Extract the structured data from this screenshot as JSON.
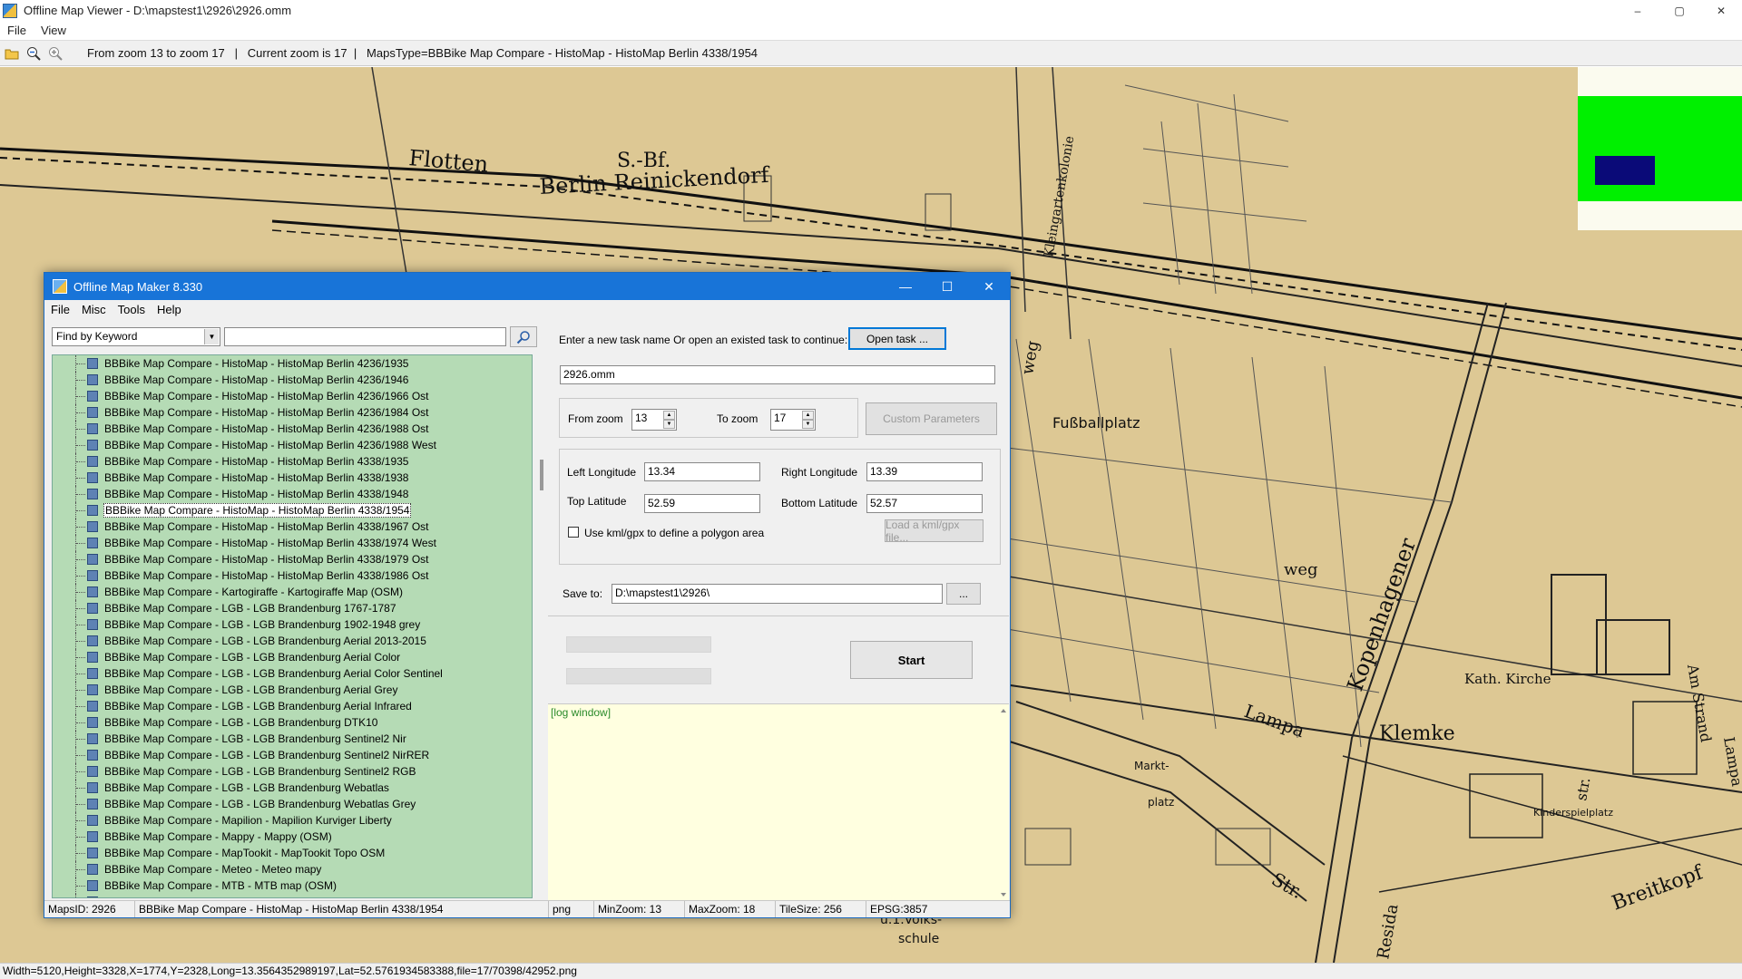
{
  "window": {
    "title": "Offline Map Viewer - D:\\mapstest1\\2926\\2926.omm",
    "controls": {
      "minimize": "–",
      "maximize": "▢",
      "close": "✕"
    }
  },
  "menu": [
    "File",
    "View"
  ],
  "toolbar": {
    "icons": [
      "open-folder-icon",
      "zoom-out-icon",
      "zoom-in-icon"
    ],
    "info": "From zoom 13 to zoom 17   |   Current zoom is 17  |   MapsType=BBBike Map Compare - HistoMap - HistoMap Berlin 4338/1954"
  },
  "map": {
    "labels": [
      "S.-Bf.",
      "Berlin-Reinickendorf",
      "Flotten",
      "Kleingartenkolonie",
      "Fußballplatz",
      "weg",
      "Kopenhagener",
      "Klemke",
      "Kath. Kirche",
      "Am Strand",
      "Kinderspielplatz",
      "Markt-",
      "platz",
      "Str.",
      "Breitkopf",
      "Resida",
      "u.1.Volks-",
      "schule",
      "str.",
      "weg",
      "Lampa"
    ],
    "overview_colors": {
      "background": "#fbfbef",
      "area": "#00f000",
      "viewport": "#0a0a78"
    }
  },
  "status_bar": "Width=5120,Height=3328,X=1774,Y=2328,Long=13.3564352989197,Lat=52.5761934583388,file=17/70398/42952.png",
  "dialog": {
    "title": "Offline Map Maker 8.330",
    "controls": {
      "minimize": "—",
      "maximize": "☐",
      "close": "✕"
    },
    "menu": [
      "File",
      "Misc",
      "Tools",
      "Help"
    ],
    "find": {
      "mode": "Find by Keyword",
      "query": ""
    },
    "tree_items": [
      "BBBike Map Compare - HistoMap - HistoMap Berlin 4236/1935",
      "BBBike Map Compare - HistoMap - HistoMap Berlin 4236/1946",
      "BBBike Map Compare - HistoMap - HistoMap Berlin 4236/1966 Ost",
      "BBBike Map Compare - HistoMap - HistoMap Berlin 4236/1984 Ost",
      "BBBike Map Compare - HistoMap - HistoMap Berlin 4236/1988 Ost",
      "BBBike Map Compare - HistoMap - HistoMap Berlin 4236/1988 West",
      "BBBike Map Compare - HistoMap - HistoMap Berlin 4338/1935",
      "BBBike Map Compare - HistoMap - HistoMap Berlin 4338/1938",
      "BBBike Map Compare - HistoMap - HistoMap Berlin 4338/1948",
      "BBBike Map Compare - HistoMap - HistoMap Berlin 4338/1954",
      "BBBike Map Compare - HistoMap - HistoMap Berlin 4338/1967 Ost",
      "BBBike Map Compare - HistoMap - HistoMap Berlin 4338/1974 West",
      "BBBike Map Compare - HistoMap - HistoMap Berlin 4338/1979 Ost",
      "BBBike Map Compare - HistoMap - HistoMap Berlin 4338/1986 Ost",
      "BBBike Map Compare - Kartogiraffe - Kartogiraffe Map (OSM)",
      "BBBike Map Compare - LGB - LGB Brandenburg 1767-1787",
      "BBBike Map Compare - LGB - LGB Brandenburg 1902-1948 grey",
      "BBBike Map Compare - LGB - LGB Brandenburg Aerial 2013-2015",
      "BBBike Map Compare - LGB - LGB Brandenburg Aerial Color",
      "BBBike Map Compare - LGB - LGB Brandenburg Aerial Color Sentinel",
      "BBBike Map Compare - LGB - LGB Brandenburg Aerial Grey",
      "BBBike Map Compare - LGB - LGB Brandenburg Aerial Infrared",
      "BBBike Map Compare - LGB - LGB Brandenburg DTK10",
      "BBBike Map Compare - LGB - LGB Brandenburg Sentinel2 Nir",
      "BBBike Map Compare - LGB - LGB Brandenburg Sentinel2 NirRER",
      "BBBike Map Compare - LGB - LGB Brandenburg Sentinel2 RGB",
      "BBBike Map Compare - LGB - LGB Brandenburg Webatlas",
      "BBBike Map Compare - LGB - LGB Brandenburg Webatlas Grey",
      "BBBike Map Compare - Mapilion - Mapilion Kurviger Liberty",
      "BBBike Map Compare - Mappy - Mappy (OSM)",
      "BBBike Map Compare - MapTookit - MapTookit Topo OSM",
      "BBBike Map Compare - Meteo - Meteo mapy",
      "BBBike Map Compare - MTB - MTB map (OSM)",
      "BBBike Map Compare - MTB - MTB map Norway (OSM)"
    ],
    "selected_index": 9,
    "task_prompt": "Enter a new task name Or open an existed task to continue:",
    "open_task_label": "Open task ...",
    "task_name": "2926.omm",
    "from_zoom_label": "From zoom",
    "from_zoom": "13",
    "to_zoom_label": "To zoom",
    "to_zoom": "17",
    "custom_params_label": "Custom Parameters",
    "left_lon_label": "Left Longitude",
    "left_lon": "13.34",
    "right_lon_label": "Right Longitude",
    "right_lon": "13.39",
    "top_lat_label": "Top Latitude",
    "top_lat": "52.59",
    "bottom_lat_label": "Bottom Latitude",
    "bottom_lat": "52.57",
    "kml_label": "Use kml/gpx to define a polygon area",
    "kml_checked": false,
    "load_kml_label": "Load a kml/gpx file...",
    "save_to_label": "Save to:",
    "save_path": "D:\\mapstest1\\2926\\",
    "browse_label": "...",
    "start_label": "Start",
    "log_label": "[log window]",
    "status": {
      "maps_id": "MapsID: 2926",
      "map_name": "BBBike Map Compare - HistoMap - HistoMap Berlin 4338/1954",
      "format": "png",
      "min_zoom": "MinZoom: 13",
      "max_zoom": "MaxZoom: 18",
      "tile_size": "TileSize: 256",
      "epsg": "EPSG:3857"
    }
  }
}
